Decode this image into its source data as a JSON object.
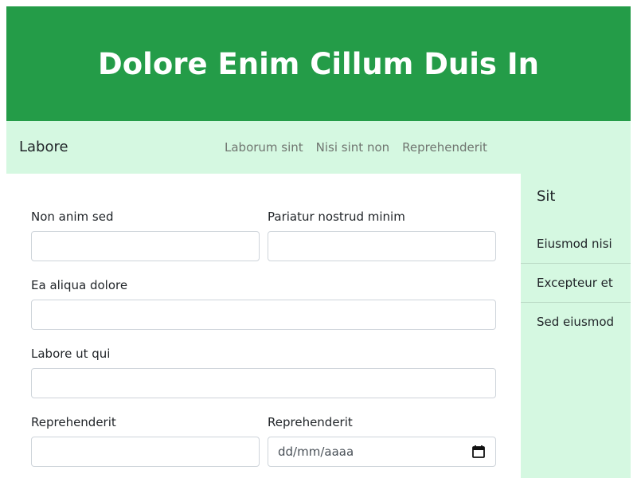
{
  "header": {
    "title": "Dolore Enim Cillum Duis In"
  },
  "navbar": {
    "brand": "Labore",
    "links": [
      "Laborum sint",
      "Nisi sint non",
      "Reprehenderit"
    ]
  },
  "form": {
    "field1": {
      "label": "Non anim sed",
      "value": ""
    },
    "field2": {
      "label": "Pariatur nostrud minim",
      "value": ""
    },
    "field3": {
      "label": "Ea aliqua dolore",
      "value": ""
    },
    "field4": {
      "label": "Labore ut qui",
      "value": ""
    },
    "field5": {
      "label": "Reprehenderit",
      "value": ""
    },
    "field6": {
      "label": "Reprehenderit",
      "placeholder": "dd/mm/aaaa"
    }
  },
  "sidebar": {
    "title": "Sit",
    "items": [
      "Eiusmod nisi",
      "Excepteur et",
      "Sed eiusmod"
    ]
  }
}
